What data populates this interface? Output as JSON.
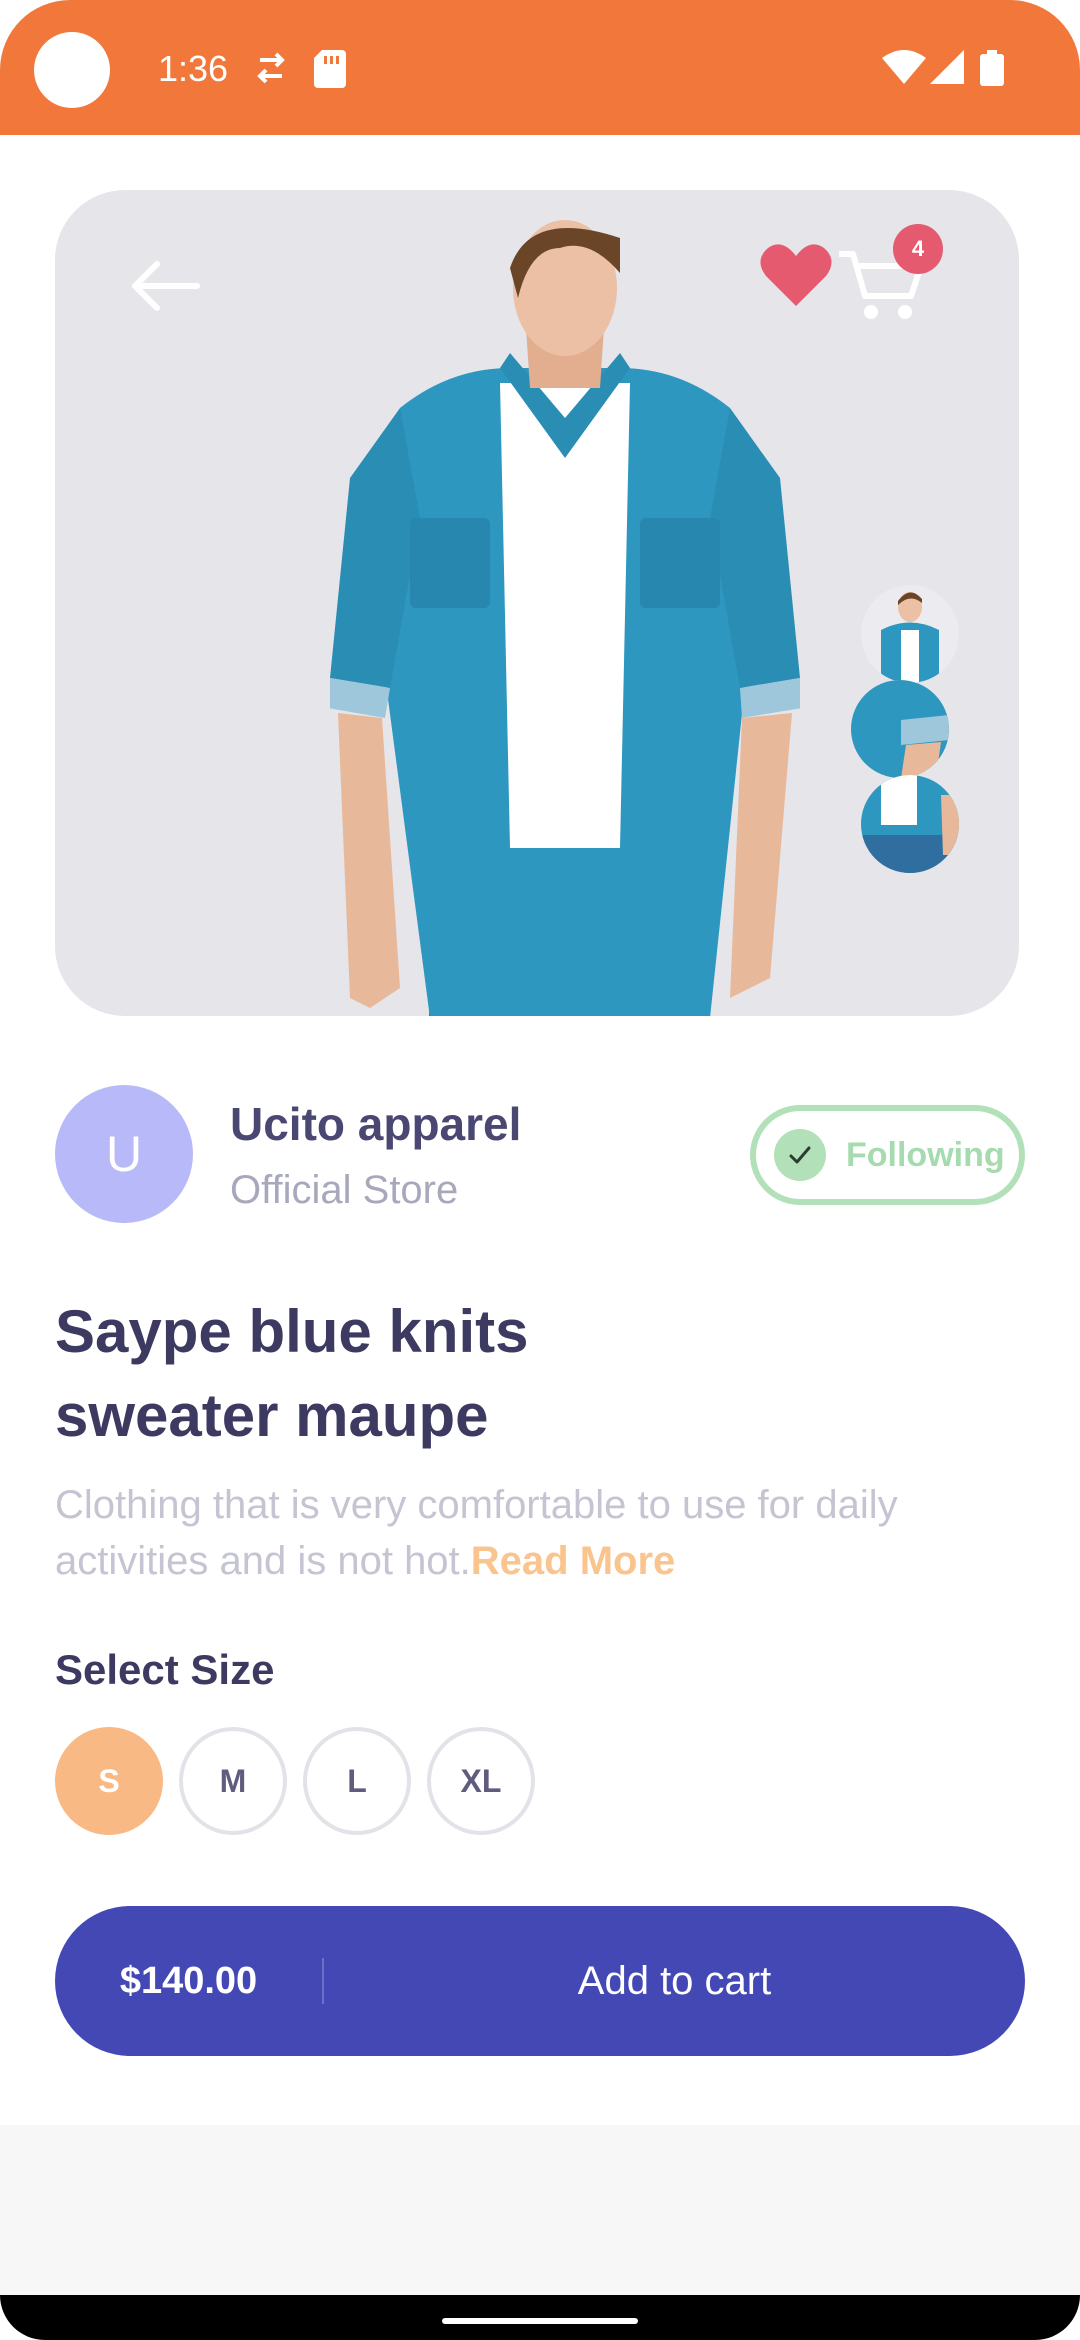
{
  "status_bar": {
    "time": "1:36"
  },
  "hero": {
    "cart_count": "4"
  },
  "store": {
    "avatar_letter": "U",
    "name": "Ucito apparel",
    "subtitle": "Official Store",
    "follow_label": "Following"
  },
  "product": {
    "title": "Saype blue knits sweater maupe",
    "description": "Clothing that is very comfortable to use for daily activities and is not hot.",
    "read_more": "Read More"
  },
  "sizes": {
    "heading": "Select Size",
    "options": [
      "S",
      "M",
      "L",
      "XL"
    ],
    "selected": "S"
  },
  "cart": {
    "price": "$140.00",
    "add_label": "Add to cart"
  },
  "colors": {
    "status_bar": "#F2773B",
    "primary": "#4348B5",
    "accent": "#F9B985",
    "follow": "#B2E0B9",
    "favorite": "#E55A6E"
  },
  "icons": [
    "back-arrow-icon",
    "heart-icon",
    "cart-icon",
    "check-icon",
    "wifi-icon",
    "signal-icon",
    "battery-icon",
    "sd-card-icon",
    "sync-icon"
  ]
}
